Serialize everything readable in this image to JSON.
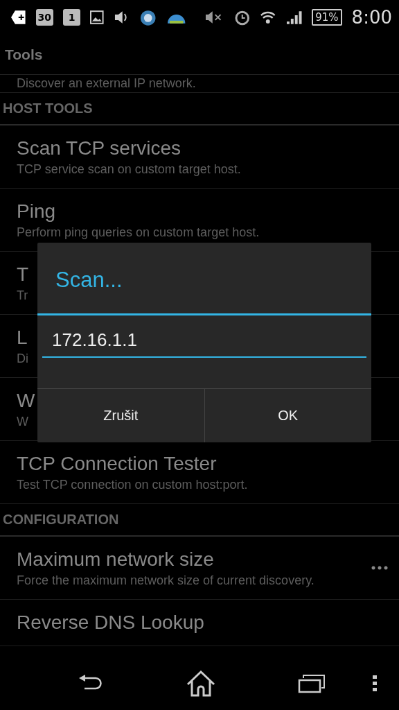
{
  "status_bar": {
    "calendar_date": "30",
    "calendar_day": "1",
    "battery": "91%",
    "time": "8:00"
  },
  "app_bar": {
    "title": "Tools"
  },
  "list": [
    {
      "kind": "item",
      "summary": "Discover an external IP network."
    },
    {
      "kind": "section",
      "label": "HOST TOOLS"
    },
    {
      "kind": "item",
      "title": "Scan TCP services",
      "summary": "TCP service scan on custom target host."
    },
    {
      "kind": "item",
      "title": "Ping",
      "summary": "Perform ping queries on custom target host."
    },
    {
      "kind": "item",
      "title": "T",
      "summary": "Tr"
    },
    {
      "kind": "item",
      "title": "L",
      "summary": "Di"
    },
    {
      "kind": "item",
      "title": "W",
      "summary": "W"
    },
    {
      "kind": "item",
      "title": "TCP Connection Tester",
      "summary": "Test TCP connection on custom host:port."
    },
    {
      "kind": "section",
      "label": "CONFIGURATION"
    },
    {
      "kind": "item",
      "title": "Maximum network size",
      "summary": "Force the maximum network size of current discovery.",
      "has_menu": true
    },
    {
      "kind": "item",
      "title": "Reverse DNS Lookup"
    }
  ],
  "dialog": {
    "title": "Scan...",
    "value": "172.16.1.1",
    "buttons": [
      "Zrušit",
      "OK"
    ]
  }
}
